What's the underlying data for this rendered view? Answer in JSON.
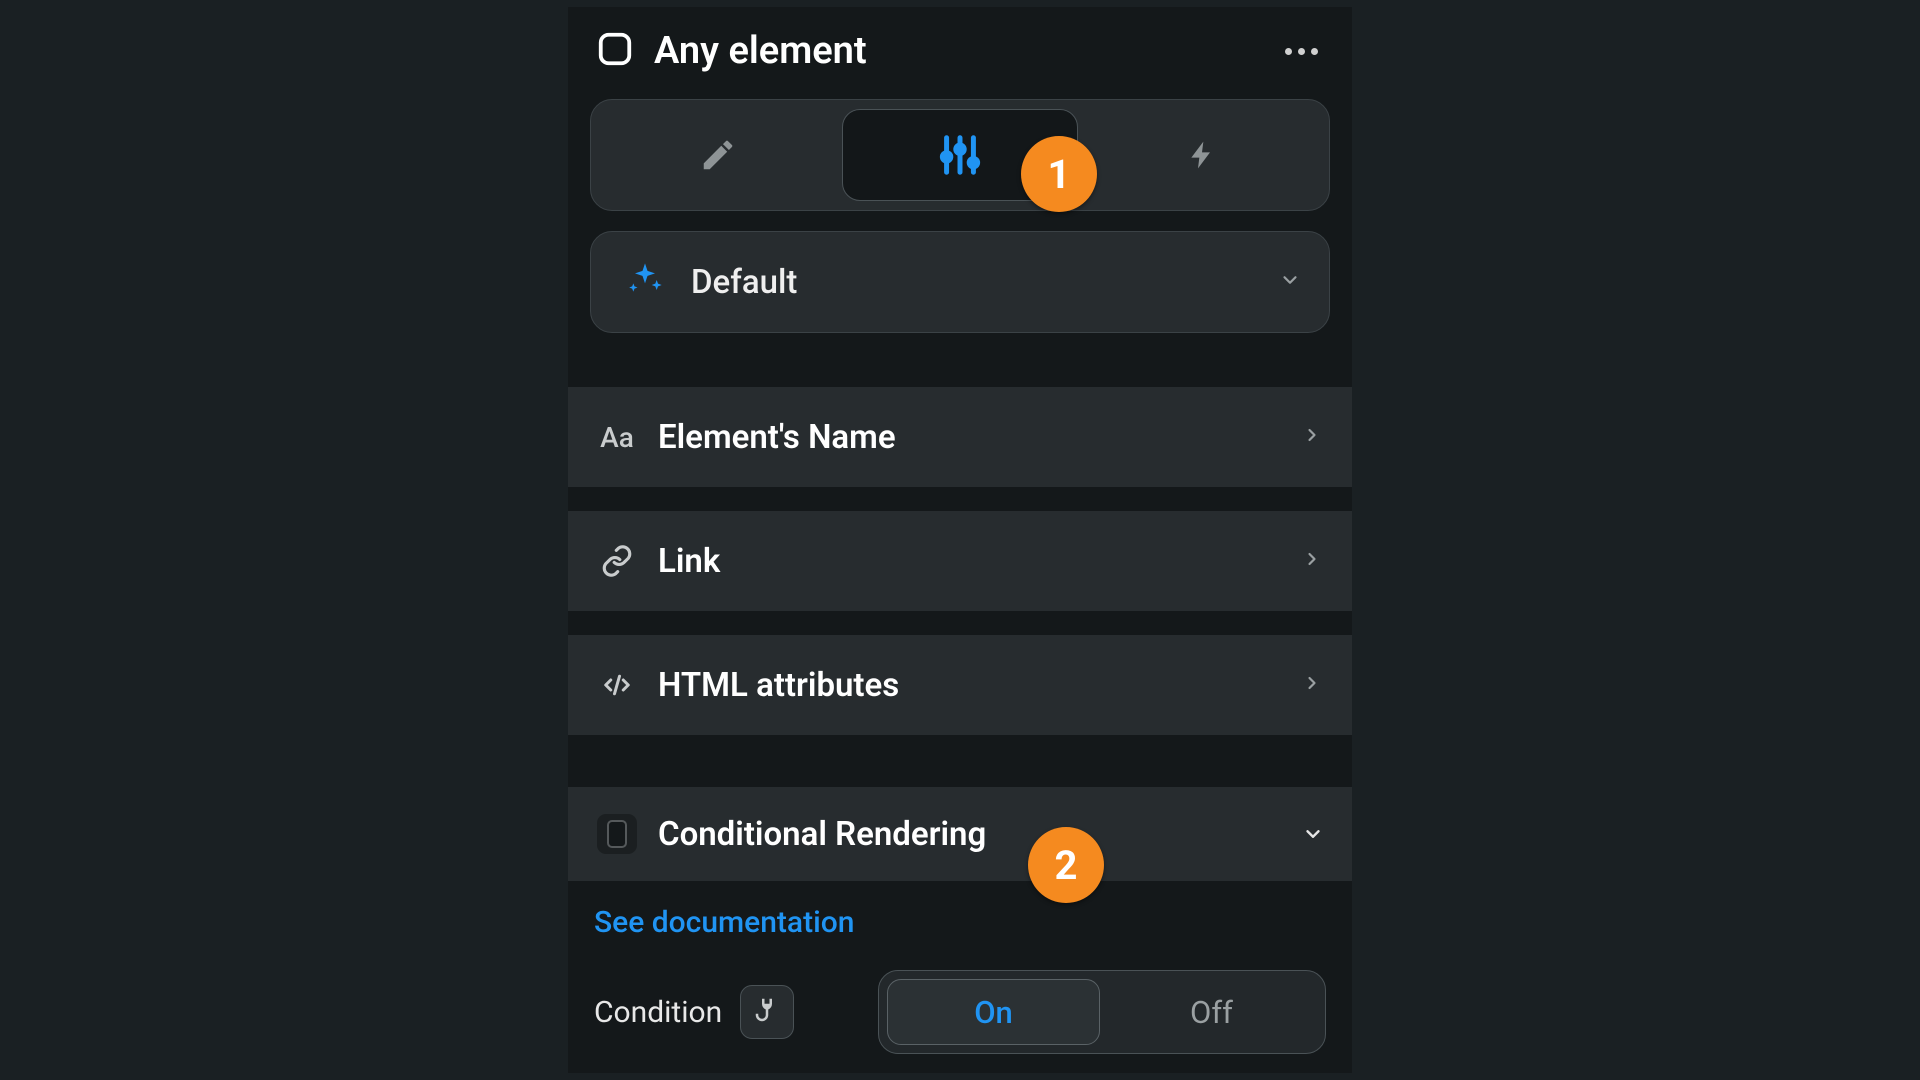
{
  "header": {
    "title": "Any element"
  },
  "tabs": {
    "active_index": 1,
    "items": [
      {
        "icon": "pencil"
      },
      {
        "icon": "sliders"
      },
      {
        "icon": "lightning"
      }
    ]
  },
  "state_selector": {
    "label": "Default"
  },
  "rows": [
    {
      "icon": "text-aa",
      "label": "Element's Name"
    },
    {
      "icon": "link",
      "label": "Link"
    },
    {
      "icon": "code",
      "label": "HTML attributes"
    }
  ],
  "conditional": {
    "header_label": "Conditional Rendering",
    "doc_link": "See documentation",
    "condition_label": "Condition",
    "toggle": {
      "on": "On",
      "off": "Off",
      "value": "On"
    }
  },
  "callouts": {
    "one": "1",
    "two": "2"
  },
  "colors": {
    "accent_blue": "#2094f3",
    "callout_orange": "#f58a1f",
    "panel_bg": "#14181a",
    "row_bg": "#272c2f"
  }
}
